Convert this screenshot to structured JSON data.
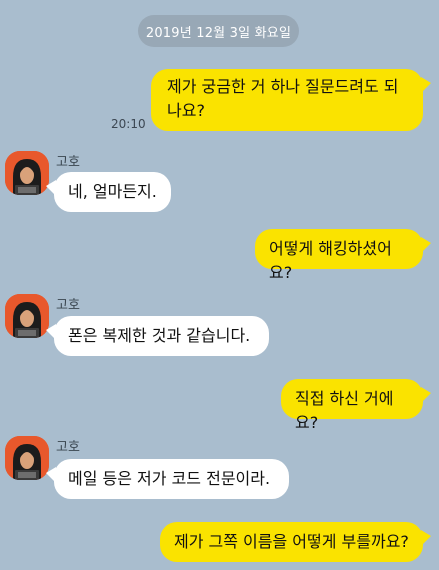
{
  "date_divider": "2019년 12월  3일 화요일",
  "messages": [
    {
      "from": "me",
      "text": "제가 궁금한 거 하나 질문드려도 되나요?",
      "time": "20:10"
    },
    {
      "from": "them",
      "sender": "고호",
      "text": "네, 얼마든지."
    },
    {
      "from": "me",
      "text": "어떻게 해킹하셨어요?"
    },
    {
      "from": "them",
      "sender": "고호",
      "text": "폰은 복제한 것과 같습니다."
    },
    {
      "from": "me",
      "text": "직접 하신 거에요?"
    },
    {
      "from": "them",
      "sender": "고호",
      "text": "메일 등은 저가 코드 전문이라."
    },
    {
      "from": "me",
      "text": "제가 그쪽 이름을 어떻게 부를까요?"
    }
  ],
  "colors": {
    "background": "#a9bdce",
    "my_bubble": "#fae300",
    "their_bubble": "#ffffff",
    "avatar_bg": "#e8582c"
  },
  "icons": {
    "avatar": "hacker-avatar-icon"
  }
}
